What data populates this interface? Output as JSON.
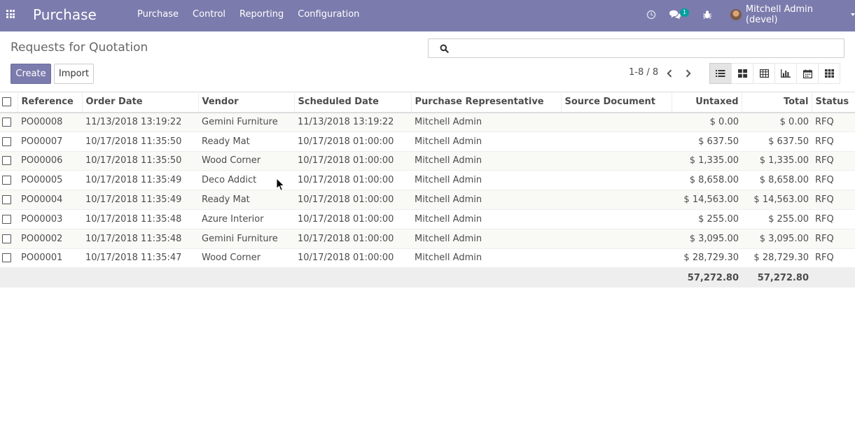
{
  "navbar": {
    "app_title": "Purchase",
    "menu": [
      "Purchase",
      "Control",
      "Reporting",
      "Configuration"
    ],
    "chat_badge": "1",
    "user_name": "Mitchell Admin (devel)",
    "color": "#7c7bad"
  },
  "control_panel": {
    "title": "Requests for Quotation",
    "search_placeholder": "",
    "create_label": "Create",
    "import_label": "Import",
    "pager": "1-8 / 8",
    "views": [
      "list-view-icon",
      "kanban-view-icon",
      "pivot-view-icon",
      "graph-view-icon",
      "calendar-view-icon",
      "activity-view-icon"
    ],
    "active_view": "list-view-icon"
  },
  "table": {
    "columns": [
      "Reference",
      "Order Date",
      "Vendor",
      "Scheduled Date",
      "Purchase Representative",
      "Source Document",
      "Untaxed",
      "Total",
      "Status"
    ],
    "rows": [
      [
        "PO00008",
        "11/13/2018 13:19:22",
        "Gemini Furniture",
        "11/13/2018 13:19:22",
        "Mitchell Admin",
        "",
        "$ 0.00",
        "$ 0.00",
        "RFQ"
      ],
      [
        "PO00007",
        "10/17/2018 11:35:50",
        "Ready Mat",
        "10/17/2018 01:00:00",
        "Mitchell Admin",
        "",
        "$ 637.50",
        "$ 637.50",
        "RFQ"
      ],
      [
        "PO00006",
        "10/17/2018 11:35:50",
        "Wood Corner",
        "10/17/2018 01:00:00",
        "Mitchell Admin",
        "",
        "$ 1,335.00",
        "$ 1,335.00",
        "RFQ"
      ],
      [
        "PO00005",
        "10/17/2018 11:35:49",
        "Deco Addict",
        "10/17/2018 01:00:00",
        "Mitchell Admin",
        "",
        "$ 8,658.00",
        "$ 8,658.00",
        "RFQ"
      ],
      [
        "PO00004",
        "10/17/2018 11:35:49",
        "Ready Mat",
        "10/17/2018 01:00:00",
        "Mitchell Admin",
        "",
        "$ 14,563.00",
        "$ 14,563.00",
        "RFQ"
      ],
      [
        "PO00003",
        "10/17/2018 11:35:48",
        "Azure Interior",
        "10/17/2018 01:00:00",
        "Mitchell Admin",
        "",
        "$ 255.00",
        "$ 255.00",
        "RFQ"
      ],
      [
        "PO00002",
        "10/17/2018 11:35:48",
        "Gemini Furniture",
        "10/17/2018 01:00:00",
        "Mitchell Admin",
        "",
        "$ 3,095.00",
        "$ 3,095.00",
        "RFQ"
      ],
      [
        "PO00001",
        "10/17/2018 11:35:47",
        "Wood Corner",
        "10/17/2018 01:00:00",
        "Mitchell Admin",
        "",
        "$ 28,729.30",
        "$ 28,729.30",
        "RFQ"
      ]
    ],
    "totals": {
      "untaxed": "57,272.80",
      "total": "57,272.80"
    }
  }
}
